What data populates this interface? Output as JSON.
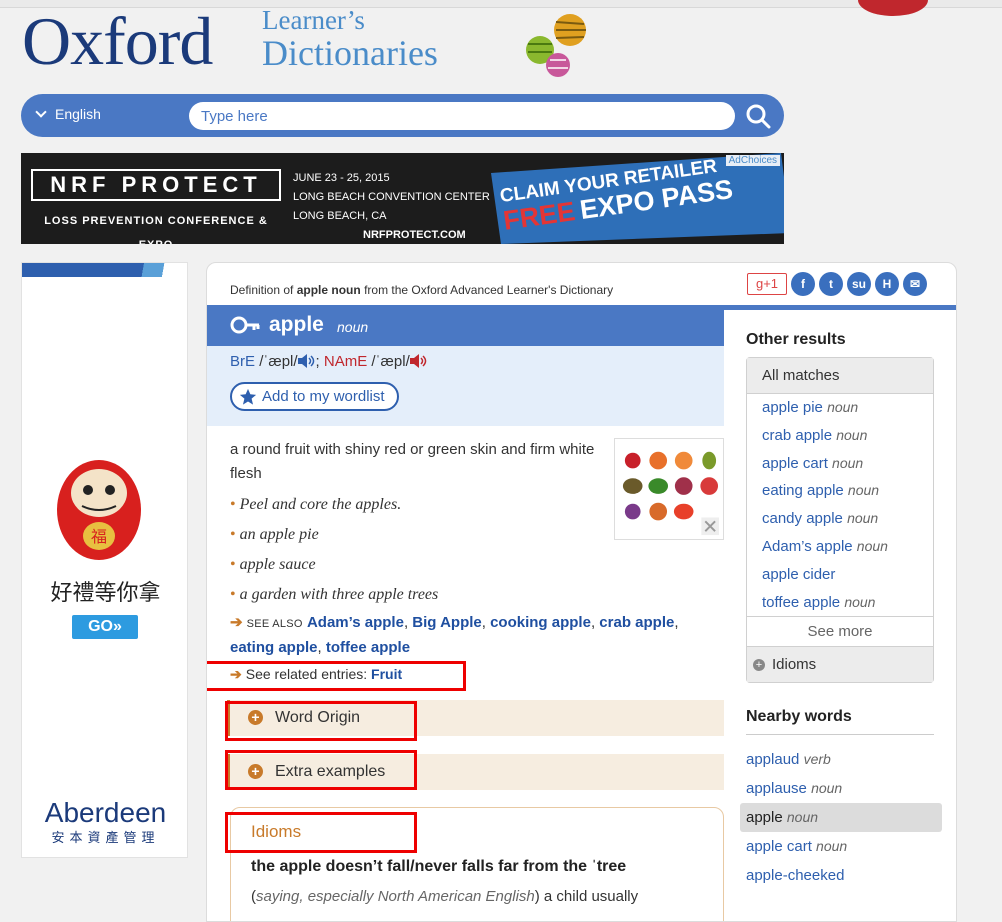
{
  "logo": {
    "main": "Oxford",
    "line1": "Learner’s",
    "line2": "Dictionaries"
  },
  "search": {
    "language": "English",
    "placeholder": "Type here"
  },
  "banner": {
    "brand": "NRF PROTECT",
    "sub": "LOSS PREVENTION CONFERENCE & EXPO",
    "date": "JUNE 23 - 25, 2015",
    "venue": "LONG BEACH CONVENTION CENTER",
    "city": "LONG BEACH, CA",
    "url": "NRFPROTECT.COM",
    "claim_line1": "CLAIM YOUR RETAILER",
    "claim_free": "FREE",
    "claim_expo": "EXPO PASS",
    "adchoices": "AdChoices"
  },
  "left_ad": {
    "chinese": "好禮等你拿",
    "go": "GO»",
    "brand": "Aberdeen",
    "brand_cn": "安本資產管理"
  },
  "entry": {
    "definition_of_prefix": "Definition of",
    "definition_of_word": "apple noun",
    "definition_of_suffix": "from the Oxford Advanced Learner's Dictionary",
    "headword": "apple",
    "pos": "noun",
    "bre_label": "BrE",
    "bre_ipa": "/ˈæpl/",
    "name_label": "NAmE",
    "name_ipa": "/ˈæpl/",
    "wordlist_label": "Add to my wordlist",
    "definition": "a round fruit with shiny red or green skin and firm white flesh",
    "examples": [
      "Peel and core the apples.",
      "an apple pie",
      "apple sauce",
      "a garden with three apple trees"
    ],
    "see_also_label": "SEE ALSO",
    "see_also": [
      "Adam’s apple",
      "Big Apple",
      "cooking apple",
      "crab apple",
      "eating apple",
      "toffee apple"
    ],
    "related_label": "See related entries:",
    "related": "Fruit",
    "word_origin": "Word Origin",
    "extra_examples": "Extra examples",
    "idioms_title": "Idioms",
    "idiom_phrase": "the apple doesn’t fall/never falls far from the ˈtree",
    "idiom_register": "saying, especially North American English",
    "idiom_def": "a child usually"
  },
  "share": {
    "gplus": "g+1"
  },
  "sidebar": {
    "other_results": "Other results",
    "all_matches": "All matches",
    "matches": [
      {
        "word": "apple pie",
        "pos": "noun"
      },
      {
        "word": "crab apple",
        "pos": "noun"
      },
      {
        "word": "apple cart",
        "pos": "noun"
      },
      {
        "word": "eating apple",
        "pos": "noun"
      },
      {
        "word": "candy apple",
        "pos": "noun"
      },
      {
        "word": "Adam’s apple",
        "pos": "noun"
      },
      {
        "word": "apple cider",
        "pos": ""
      },
      {
        "word": "toffee apple",
        "pos": "noun"
      }
    ],
    "see_more": "See more",
    "idioms": "Idioms",
    "nearby_title": "Nearby words",
    "nearby": [
      {
        "word": "applaud",
        "pos": "verb"
      },
      {
        "word": "applause",
        "pos": "noun"
      },
      {
        "word": "apple",
        "pos": "noun"
      },
      {
        "word": "apple cart",
        "pos": "noun"
      },
      {
        "word": "apple-cheeked",
        "pos": ""
      }
    ]
  },
  "colors": {
    "brand_blue": "#4a78c4",
    "accent_orange": "#c87a2a",
    "highlight_red": "#e00000"
  }
}
